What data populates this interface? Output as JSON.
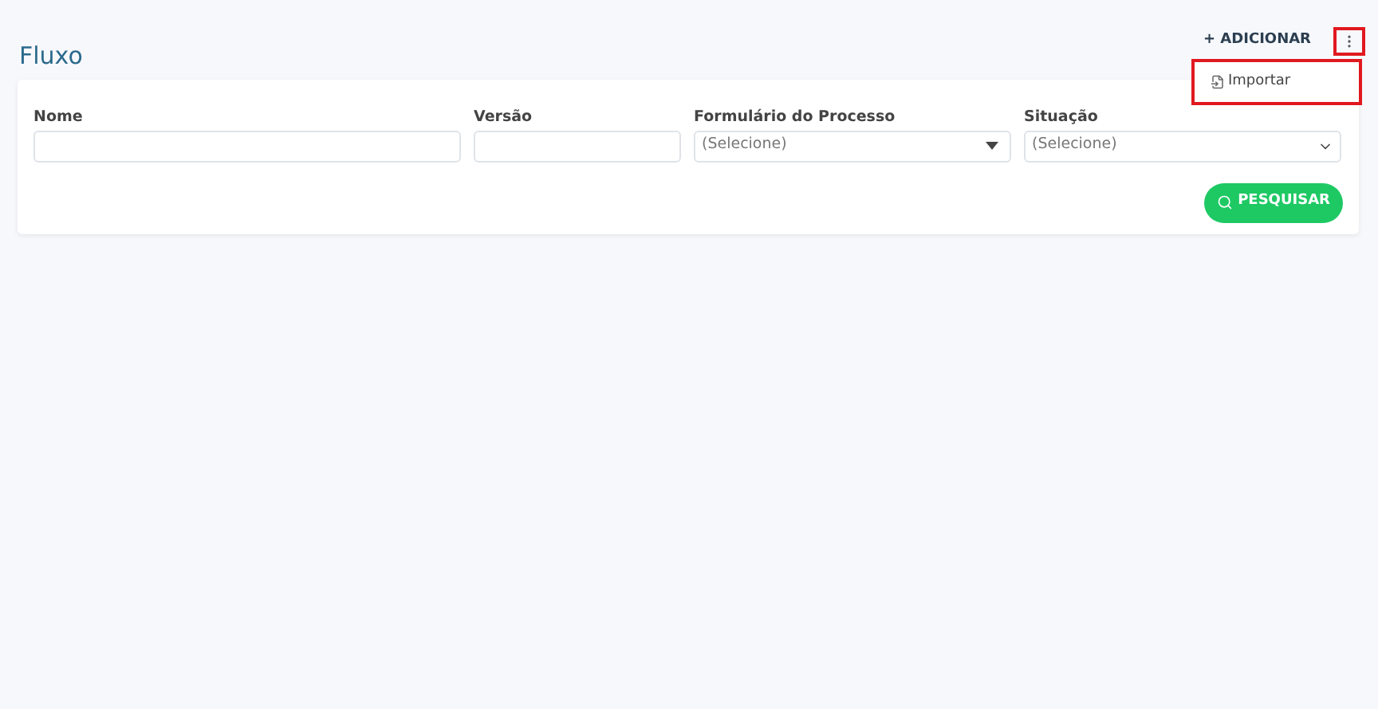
{
  "page": {
    "title": "Fluxo"
  },
  "toolbar": {
    "add_button": {
      "label": "+ ADICIONAR"
    },
    "more_button": {
      "expanded": true
    },
    "menu": [
      {
        "label": "Importar"
      }
    ]
  },
  "filters": [
    {
      "kind": "text",
      "label": "Nome"
    },
    {
      "kind": "text",
      "label": "Versão"
    },
    {
      "kind": "dropdown",
      "label": "Formulário do Processo",
      "value": "(Selecione)"
    },
    {
      "kind": "select",
      "label": "Situação",
      "value": "(Selecione)"
    }
  ],
  "search_button": {
    "label": "PESQUISAR"
  }
}
